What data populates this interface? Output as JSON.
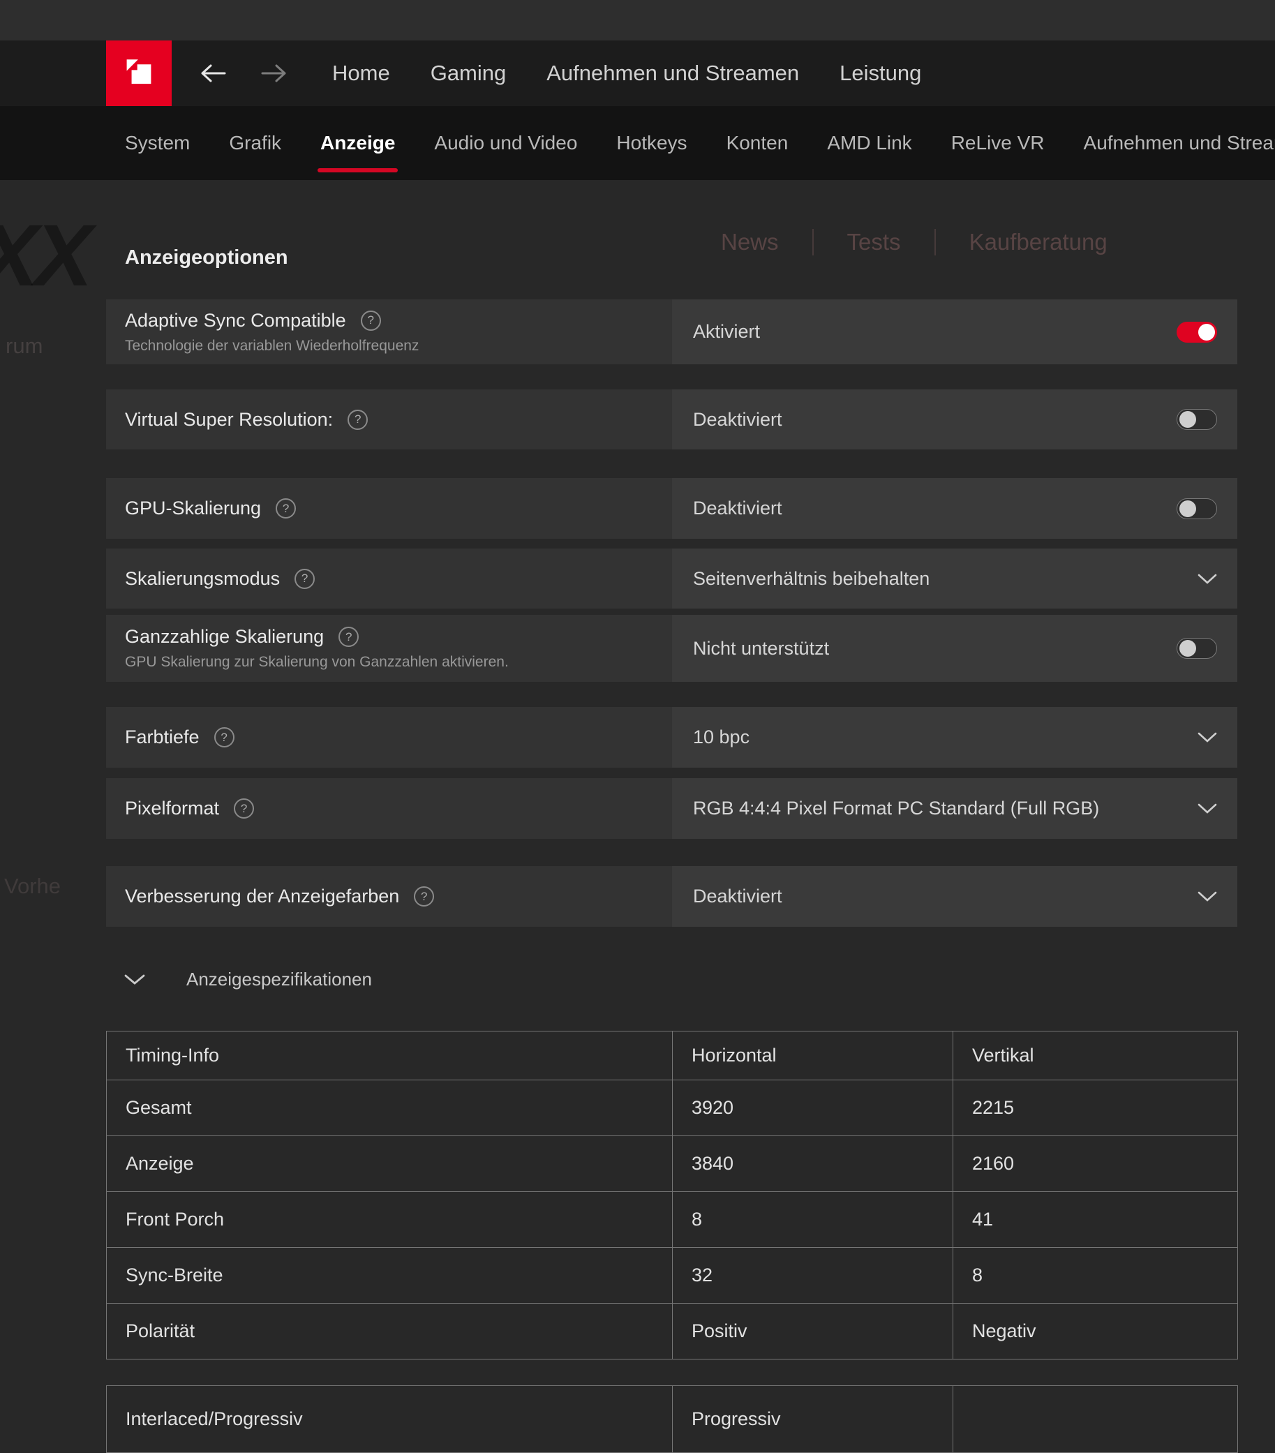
{
  "topbar": {
    "nav_items": [
      "Home",
      "Gaming",
      "Aufnehmen und Streamen",
      "Leistung"
    ]
  },
  "tabs": {
    "items": [
      {
        "label": "System"
      },
      {
        "label": "Grafik"
      },
      {
        "label": "Anzeige"
      },
      {
        "label": "Audio und Video"
      },
      {
        "label": "Hotkeys"
      },
      {
        "label": "Konten"
      },
      {
        "label": "AMD Link"
      },
      {
        "label": "ReLive VR"
      },
      {
        "label": "Aufnehmen und Streamen"
      }
    ],
    "active_tab": "Anzeige"
  },
  "page": {
    "title": "Anzeigeoptionen",
    "specs_section_label": "Anzeigespezifikationen"
  },
  "settings": [
    {
      "label": "Adaptive Sync Compatible",
      "sublabel": "Technologie der variablen Wiederholfrequenz",
      "value": "Aktiviert",
      "control": "toggle-on"
    },
    {
      "label": "Virtual Super Resolution:",
      "value": "Deaktiviert",
      "control": "toggle-off"
    },
    {
      "label": "GPU-Skalierung",
      "value": "Deaktiviert",
      "control": "toggle-off"
    },
    {
      "label": "Skalierungsmodus",
      "value": "Seitenverhältnis beibehalten",
      "control": "dropdown"
    },
    {
      "label": "Ganzzahlige Skalierung",
      "sublabel": "GPU Skalierung zur Skalierung von Ganzzahlen aktivieren.",
      "value": "Nicht unterstützt",
      "control": "toggle-off"
    },
    {
      "label": "Farbtiefe",
      "value": "10 bpc",
      "control": "dropdown"
    },
    {
      "label": "Pixelformat",
      "value": "RGB 4:4:4 Pixel Format PC Standard (Full RGB)",
      "control": "dropdown"
    },
    {
      "label": "Verbesserung der Anzeigefarben",
      "value": "Deaktiviert",
      "control": "dropdown"
    }
  ],
  "timing_table": {
    "headers": [
      "Timing-Info",
      "Horizontal",
      "Vertikal"
    ],
    "rows": [
      [
        "Gesamt",
        "3920",
        "2215"
      ],
      [
        "Anzeige",
        "3840",
        "2160"
      ],
      [
        "Front Porch",
        "8",
        "41"
      ],
      [
        "Sync-Breite",
        "32",
        "8"
      ],
      [
        "Polarität",
        "Positiv",
        "Negativ"
      ]
    ],
    "extra_rows": [
      [
        "Interlaced/Progressiv",
        "Progressiv",
        ""
      ]
    ]
  },
  "background_page": {
    "menu_items": [
      "News",
      "Tests",
      "Kaufberatung"
    ],
    "logo_fragment": "XX",
    "fragment_left": "rum",
    "fragment_bottom": "Vorhe"
  },
  "colors": {
    "accent_red": "#e50020",
    "toggle_on_red": "#df0321",
    "tab_underline_red": "#d50724"
  }
}
